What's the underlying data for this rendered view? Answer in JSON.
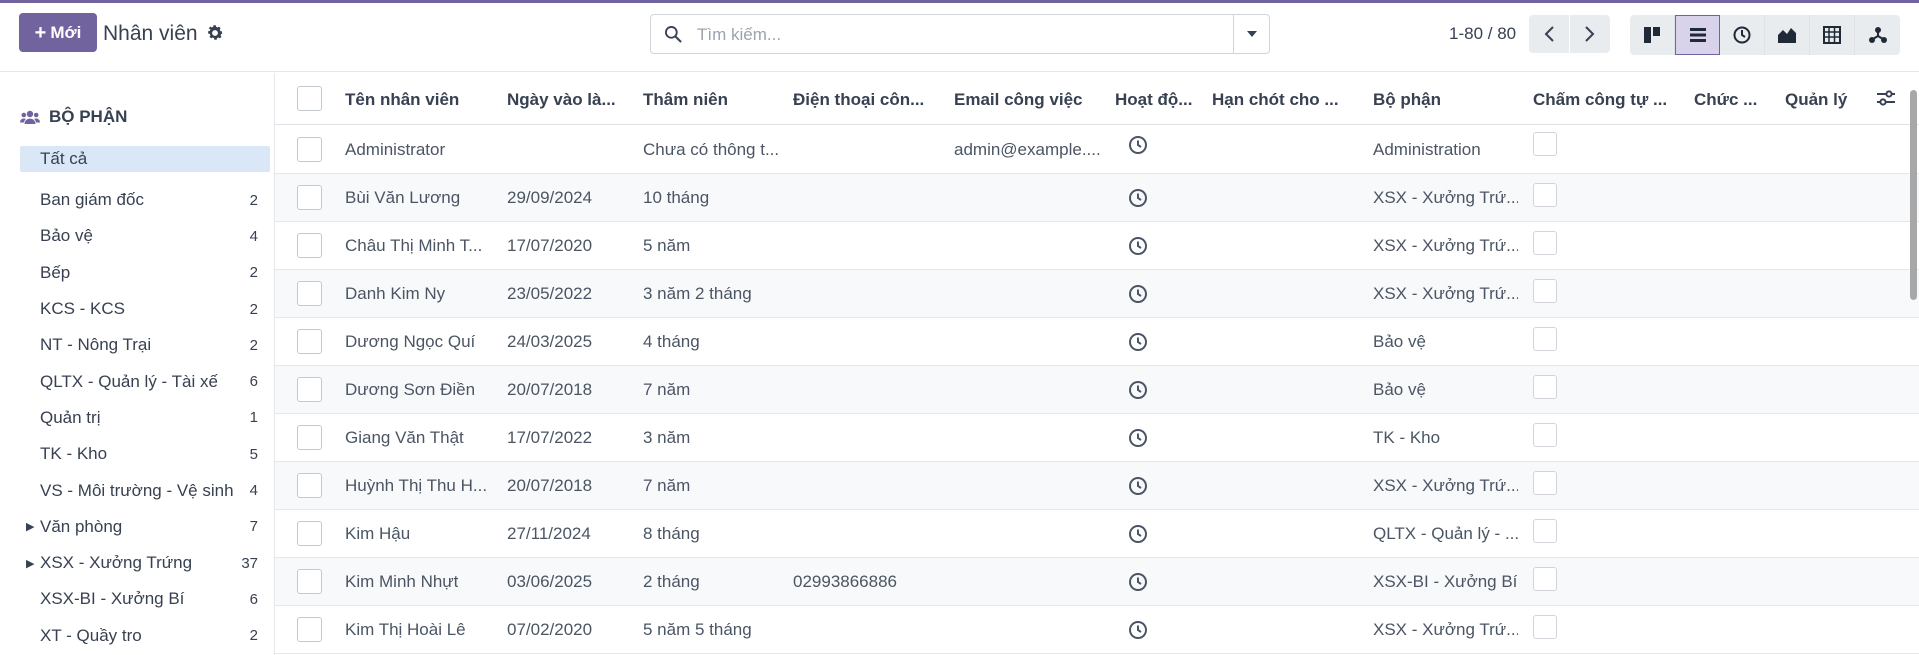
{
  "app": {
    "new_button": "Mới",
    "breadcrumb": "Nhân viên"
  },
  "search": {
    "placeholder": "Tìm kiếm..."
  },
  "pager": {
    "value": "1-80 / 80"
  },
  "views": [
    "kanban-icon",
    "list-icon",
    "activity-icon",
    "graph-icon",
    "pivot-icon",
    "hierarchy-icon"
  ],
  "sidebar": {
    "title": "BỘ PHẬN",
    "items": [
      {
        "label": "Tất cả",
        "count": "",
        "active": true,
        "expandable": false
      },
      {
        "label": "Ban giám đốc",
        "count": "2",
        "expandable": false
      },
      {
        "label": "Bảo vệ",
        "count": "4",
        "expandable": false
      },
      {
        "label": "Bếp",
        "count": "2",
        "expandable": false
      },
      {
        "label": "KCS - KCS",
        "count": "2",
        "expandable": false
      },
      {
        "label": "NT - Nông Trại",
        "count": "2",
        "expandable": false
      },
      {
        "label": "QLTX - Quản lý - Tài xế",
        "count": "6",
        "expandable": false
      },
      {
        "label": "Quản trị",
        "count": "1",
        "expandable": false
      },
      {
        "label": "TK - Kho",
        "count": "5",
        "expandable": false
      },
      {
        "label": "VS - Môi trường - Vệ sinh",
        "count": "4",
        "expandable": false
      },
      {
        "label": "Văn phòng",
        "count": "7",
        "expandable": true
      },
      {
        "label": "XSX - Xưởng Trứng",
        "count": "37",
        "expandable": true
      },
      {
        "label": "XSX-BI - Xưởng Bí",
        "count": "6",
        "expandable": false
      },
      {
        "label": "XT - Quầy tro",
        "count": "2",
        "expandable": false
      }
    ]
  },
  "table": {
    "columns": [
      "Tên nhân viên",
      "Ngày vào là...",
      "Thâm niên",
      "Điện thoại côn...",
      "Email công việc",
      "Hoạt độ...",
      "Hạn chót cho ...",
      "Bộ phận",
      "Chấm công tự ...",
      "Chức ...",
      "Quản lý"
    ],
    "rows": [
      {
        "name": "Administrator",
        "date": "",
        "seniority": "Chưa có thông t...",
        "phone": "",
        "email": "admin@example....",
        "department": "Administration"
      },
      {
        "name": "Bùi Văn Lương",
        "date": "29/09/2024",
        "seniority": "10 tháng",
        "phone": "",
        "email": "",
        "department": "XSX - Xưởng Trứ..."
      },
      {
        "name": "Châu Thị Minh T...",
        "date": "17/07/2020",
        "seniority": "5 năm",
        "phone": "",
        "email": "",
        "department": "XSX - Xưởng Trứ..."
      },
      {
        "name": "Danh Kim Ny",
        "date": "23/05/2022",
        "seniority": "3 năm 2 tháng",
        "phone": "",
        "email": "",
        "department": "XSX - Xưởng Trứ..."
      },
      {
        "name": "Dương Ngọc Quí",
        "date": "24/03/2025",
        "seniority": "4 tháng",
        "phone": "",
        "email": "",
        "department": "Bảo vệ"
      },
      {
        "name": "Dương Sơn Điền",
        "date": "20/07/2018",
        "seniority": "7 năm",
        "phone": "",
        "email": "",
        "department": "Bảo vệ"
      },
      {
        "name": "Giang Văn Thật",
        "date": "17/07/2022",
        "seniority": "3 năm",
        "phone": "",
        "email": "",
        "department": "TK - Kho"
      },
      {
        "name": "Huỳnh Thị Thu H...",
        "date": "20/07/2018",
        "seniority": "7 năm",
        "phone": "",
        "email": "",
        "department": "XSX - Xưởng Trứ..."
      },
      {
        "name": "Kim Hậu",
        "date": "27/11/2024",
        "seniority": "8 tháng",
        "phone": "",
        "email": "",
        "department": "QLTX - Quản lý - ..."
      },
      {
        "name": "Kim Minh Nhựt",
        "date": "03/06/2025",
        "seniority": "2 tháng",
        "phone": "02993866886",
        "email": "",
        "department": "XSX-BI - Xưởng Bí"
      },
      {
        "name": "Kim Thị Hoài Lê",
        "date": "07/02/2020",
        "seniority": "5 năm 5 tháng",
        "phone": "",
        "email": "",
        "department": "XSX - Xưởng Trứ..."
      }
    ]
  },
  "colors": {
    "primary": "#71639e",
    "active_filter": "#d9e7f7"
  }
}
